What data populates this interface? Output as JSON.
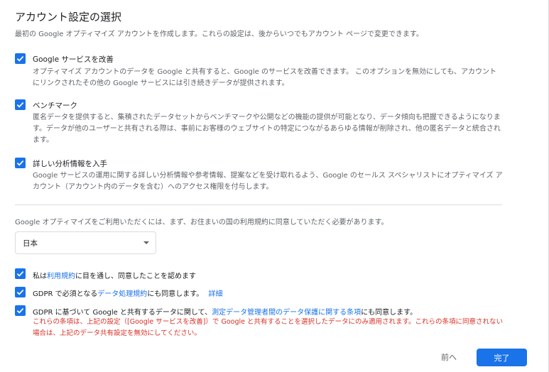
{
  "header": {
    "title": "アカウント設定の選択",
    "subtitle": "最初の Google オプティマイズ アカウントを作成します。これらの設定は、後からいつでもアカウント ページで変更できます。"
  },
  "options": [
    {
      "title": "Google サービスを改善",
      "desc": "オプティマイズ アカウントのデータを Google と共有すると、Google のサービスを改善できます。 このオプションを無効にしても、アカウントにリンクされたその他の Google サービスには引き続きデータが提供されます。",
      "checked": true
    },
    {
      "title": "ベンチマーク",
      "desc": "匿名データを提供すると、集積されたデータセットからベンチマークや公開などの機能の提供が可能となり、データ傾向も把握できるようになります。データが他のユーザーと共有される際は、事前にお客様のウェブサイトの特定につながるあらゆる情報が削除され、他の匿名データと統合されます。",
      "checked": true
    },
    {
      "title": "詳しい分析情報を入手",
      "desc": "Google サービスの運用に関する詳しい分析情報や参考情報、提案などを受け取れるよう、Google のセールス スペシャリストにオプティマイズ アカウント（アカウント内のデータを含む）へのアクセス権限を付与します。",
      "checked": true
    }
  ],
  "terms": {
    "notice": "Google オプティマイズをご利用いただくには、まず、お住まいの国の利用規約に同意していただく必要があります。",
    "country_value": "日本",
    "agree1": {
      "pre": "私は",
      "link": "利用規約",
      "post": "に目を通し、同意したことを認めます"
    },
    "agree2": {
      "pre": "GDPR で必須となる",
      "link": "データ処理規約",
      "post": "にも同意します。",
      "detail_link": "詳細"
    },
    "agree3": {
      "pre": "GDPR に基づいて Google と共有するデータに関して、",
      "link": "測定データ管理者間のデータ保護に関する条項",
      "post": "にも同意します。"
    },
    "agree3_note": "これらの条項は、上記の設定（[Google サービスを改善]）で Google と共有することを選択したデータにのみ適用されます。これらの条項に同意されない場合は、上記のデータ共有設定を無効にしてください。"
  },
  "footer": {
    "back_label": "前へ",
    "done_label": "完了"
  },
  "colors": {
    "accent": "#1a73e8",
    "warning": "#d93025"
  }
}
